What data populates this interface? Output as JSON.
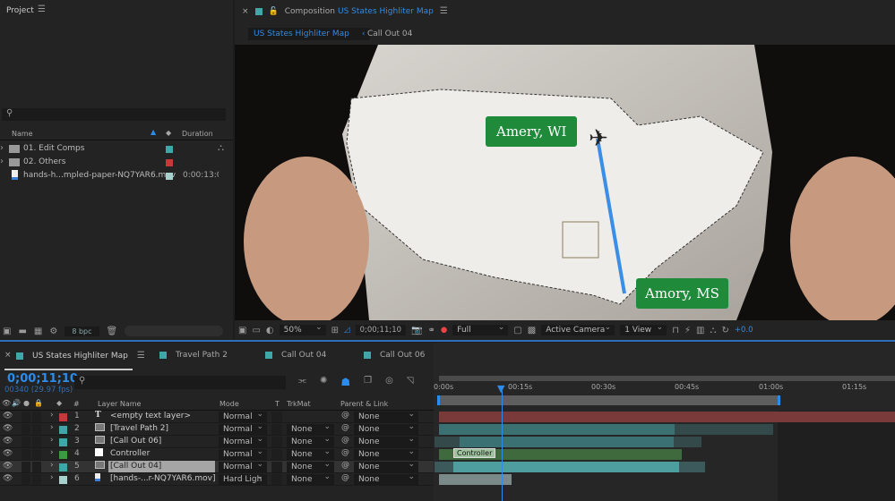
{
  "project": {
    "title": "Project",
    "search_placeholder": "",
    "col_name": "Name",
    "col_duration": "Duration",
    "items": [
      {
        "name": "01. Edit Comps",
        "type": "folder",
        "color": "#3fa7a7",
        "duration": ""
      },
      {
        "name": "02. Others",
        "type": "folder",
        "color": "#c43a3a",
        "duration": ""
      },
      {
        "name": "hands-h...mpled-paper-NQ7YAR6.mov",
        "type": "footage",
        "color": "#a8d0cc",
        "duration": "0:00:13:0"
      }
    ],
    "bpc": "8 bpc"
  },
  "comp": {
    "title_prefix": "Composition",
    "title": "US States Highliter Map",
    "breadcrumb": [
      "US States Highliter Map",
      "Call Out 04"
    ],
    "callouts": [
      "Amery, WI",
      "Amory, MS"
    ]
  },
  "viewer_toolbar": {
    "zoom": "50%",
    "timecode": "0;00;11;10",
    "resolution": "Full",
    "camera": "Active Camera",
    "views": "1 View",
    "exposure": "+0.0"
  },
  "timeline": {
    "tabs": [
      {
        "label": "US States Highliter Map",
        "color": "#3fa7a7"
      },
      {
        "label": "Travel Path 2",
        "color": "#3fa7a7"
      },
      {
        "label": "Call Out 04",
        "color": "#3fa7a7"
      },
      {
        "label": "Call Out 06",
        "color": "#3fa7a7"
      }
    ],
    "timecode": "0;00;11;10",
    "frames": "00340 (29.97 fps)",
    "headers": {
      "num": "#",
      "layer_name": "Layer Name",
      "mode": "Mode",
      "t": "T",
      "trkmat": "TrkMat",
      "parent": "Parent & Link"
    },
    "ruler": [
      "0:00s",
      "00:15s",
      "00:30s",
      "00:45s",
      "01:00s",
      "01:15s"
    ],
    "layers": [
      {
        "num": "1",
        "name": "<empty text layer>",
        "icon": "T",
        "color": "#c43a3a",
        "mode": "Normal",
        "trkmat": "",
        "parent": "None"
      },
      {
        "num": "2",
        "name": "[Travel Path 2]",
        "icon": "comp",
        "color": "#3fa7a7",
        "mode": "Normal",
        "trkmat": "None",
        "parent": "None"
      },
      {
        "num": "3",
        "name": "[Call Out 06]",
        "icon": "comp",
        "color": "#3fa7a7",
        "mode": "Normal",
        "trkmat": "None",
        "parent": "None"
      },
      {
        "num": "4",
        "name": "Controller",
        "icon": "solid",
        "color": "#3f9a3f",
        "mode": "Normal",
        "trkmat": "None",
        "parent": "None"
      },
      {
        "num": "5",
        "name": "[Call Out 04]",
        "icon": "comp",
        "color": "#3fa7a7",
        "mode": "Normal",
        "trkmat": "None",
        "parent": "None"
      },
      {
        "num": "6",
        "name": "[hands-...r-NQ7YAR6.mov]",
        "icon": "footage",
        "color": "#a8d0cc",
        "mode": "Hard Ligh",
        "trkmat": "None",
        "parent": "None"
      }
    ],
    "controller_label": "Controller"
  }
}
